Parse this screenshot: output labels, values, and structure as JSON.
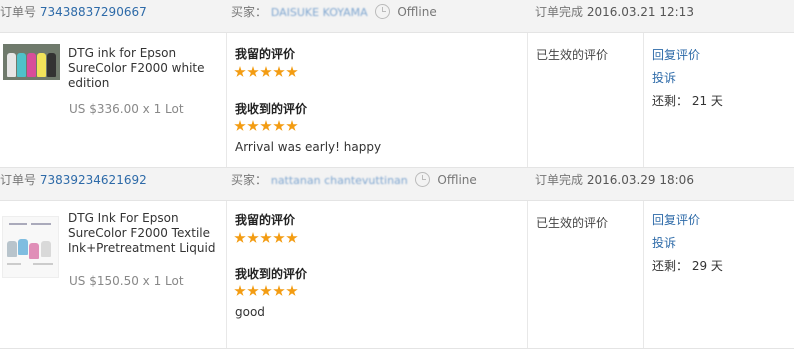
{
  "labels": {
    "order_no": "订单号",
    "buyer": "买家：",
    "offline": "Offline",
    "completed": "订单完成",
    "my_review": "我留的评价",
    "received_review": "我收到的评价",
    "status": "已生效的评价",
    "reply": "回复评价",
    "complain": "投诉",
    "remaining": "还剩："
  },
  "orders": [
    {
      "order_id": "73438837290667",
      "buyer_name": "DAISUKE KOYAMA",
      "completed_at": "2016.03.21 12:13",
      "product_title": "DTG ink for Epson SureColor F2000 white edition",
      "price": "US $336.00 x 1 Lot",
      "my_rating": 5,
      "received_rating": 5,
      "received_comment": "Arrival was early! happy",
      "remaining": "21 天"
    },
    {
      "order_id": "73839234621692",
      "buyer_name": "nattanan chantevuttinan",
      "completed_at": "2016.03.29 18:06",
      "product_title": "DTG Ink For Epson SureColor F2000 Textile Ink+Pretreatment Liquid",
      "price": "US $150.50 x 1 Lot",
      "my_rating": 5,
      "received_rating": 5,
      "received_comment": "good",
      "remaining": "29 天"
    }
  ],
  "colors": {
    "link": "#2d6aa8",
    "star": "#f39c12",
    "header_bg": "#f3f3f3"
  },
  "icons": {
    "offline_status": "clock-icon",
    "rating": "star-icon"
  }
}
